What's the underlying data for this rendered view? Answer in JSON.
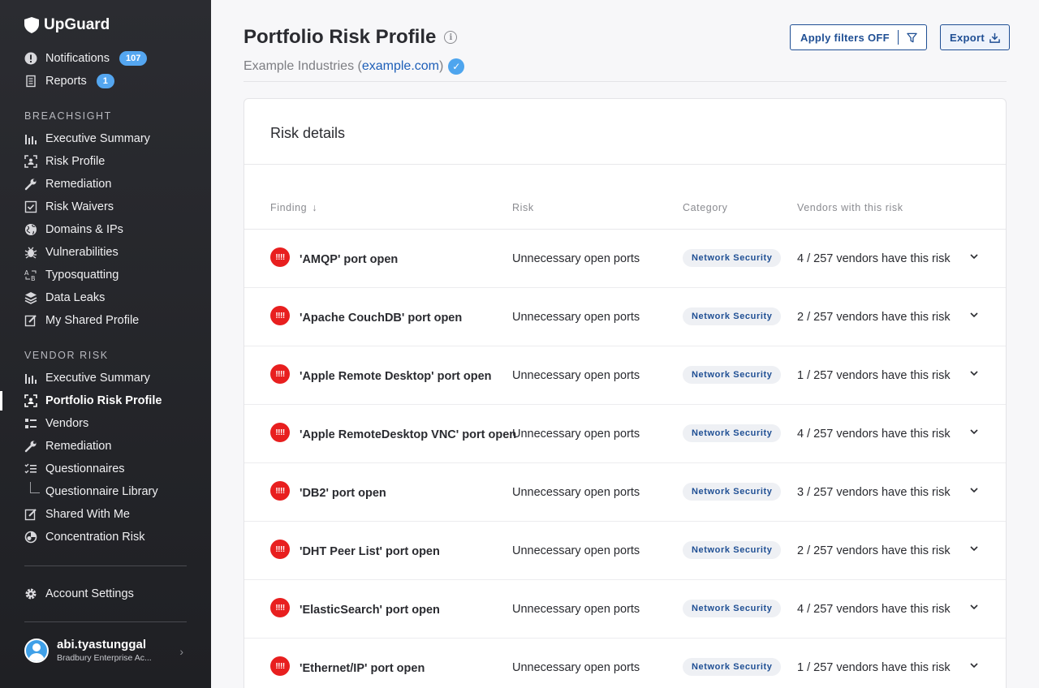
{
  "brand": {
    "name": "UpGuard"
  },
  "sidebar": {
    "top_items": [
      {
        "label": "Notifications",
        "badge": "107",
        "icon": "alert-circle-icon"
      },
      {
        "label": "Reports",
        "badge": "1",
        "icon": "document-icon"
      }
    ],
    "breachsight_title": "BREACHSIGHT",
    "breachsight_items": [
      {
        "label": "Executive Summary",
        "icon": "bar-chart-icon"
      },
      {
        "label": "Risk Profile",
        "icon": "scan-icon"
      },
      {
        "label": "Remediation",
        "icon": "wrench-icon"
      },
      {
        "label": "Risk Waivers",
        "icon": "checkbox-icon"
      },
      {
        "label": "Domains & IPs",
        "icon": "globe-icon"
      },
      {
        "label": "Vulnerabilities",
        "icon": "bug-icon"
      },
      {
        "label": "Typosquatting",
        "icon": "typo-icon"
      },
      {
        "label": "Data Leaks",
        "icon": "layers-icon"
      },
      {
        "label": "My Shared Profile",
        "icon": "edit-icon"
      }
    ],
    "vendor_title": "VENDOR RISK",
    "vendor_items": [
      {
        "label": "Executive Summary",
        "icon": "bar-chart-icon"
      },
      {
        "label": "Portfolio Risk Profile",
        "icon": "scan-icon",
        "active": true
      },
      {
        "label": "Vendors",
        "icon": "list-icon"
      },
      {
        "label": "Remediation",
        "icon": "wrench-icon"
      },
      {
        "label": "Questionnaires",
        "icon": "checklist-icon"
      },
      {
        "label": "Questionnaire Library",
        "icon": ""
      },
      {
        "label": "Shared With Me",
        "icon": "edit-icon"
      },
      {
        "label": "Concentration Risk",
        "icon": "pie-icon"
      }
    ],
    "account_settings": "Account Settings",
    "user": {
      "name": "abi.tyastunggal",
      "org": "Bradbury Enterprise Ac..."
    }
  },
  "header": {
    "title": "Portfolio Risk Profile",
    "subtitle_prefix": "Example Industries (",
    "subtitle_link": "example.com",
    "subtitle_suffix": ")",
    "apply_filters_label": "Apply filters",
    "apply_filters_state": "OFF",
    "export_label": "Export"
  },
  "card": {
    "title": "Risk details",
    "columns": [
      "Finding",
      "Risk",
      "Category",
      "Vendors with this risk"
    ],
    "rows": [
      {
        "finding": "'AMQP' port open",
        "risk": "Unnecessary open ports",
        "category": "Network Security",
        "vendors": "4 / 257 vendors have this risk"
      },
      {
        "finding": "'Apache CouchDB' port open",
        "risk": "Unnecessary open ports",
        "category": "Network Security",
        "vendors": "2 / 257 vendors have this risk"
      },
      {
        "finding": "'Apple Remote Desktop' port open",
        "risk": "Unnecessary open ports",
        "category": "Network Security",
        "vendors": "1 / 257 vendors have this risk"
      },
      {
        "finding": "'Apple RemoteDesktop VNC' port open",
        "risk": "Unnecessary open ports",
        "category": "Network Security",
        "vendors": "4 / 257 vendors have this risk"
      },
      {
        "finding": "'DB2' port open",
        "risk": "Unnecessary open ports",
        "category": "Network Security",
        "vendors": "3 / 257 vendors have this risk"
      },
      {
        "finding": "'DHT Peer List' port open",
        "risk": "Unnecessary open ports",
        "category": "Network Security",
        "vendors": "2 / 257 vendors have this risk"
      },
      {
        "finding": "'ElasticSearch' port open",
        "risk": "Unnecessary open ports",
        "category": "Network Security",
        "vendors": "4 / 257 vendors have this risk"
      },
      {
        "finding": "'Ethernet/IP' port open",
        "risk": "Unnecessary open ports",
        "category": "Network Security",
        "vendors": "1 / 257 vendors have this risk"
      }
    ]
  },
  "colors": {
    "accent": "#1f4f94",
    "severity_critical": "#e81f1f",
    "badge": "#54a6f0",
    "sidebar_bg": "#2b2c31"
  }
}
